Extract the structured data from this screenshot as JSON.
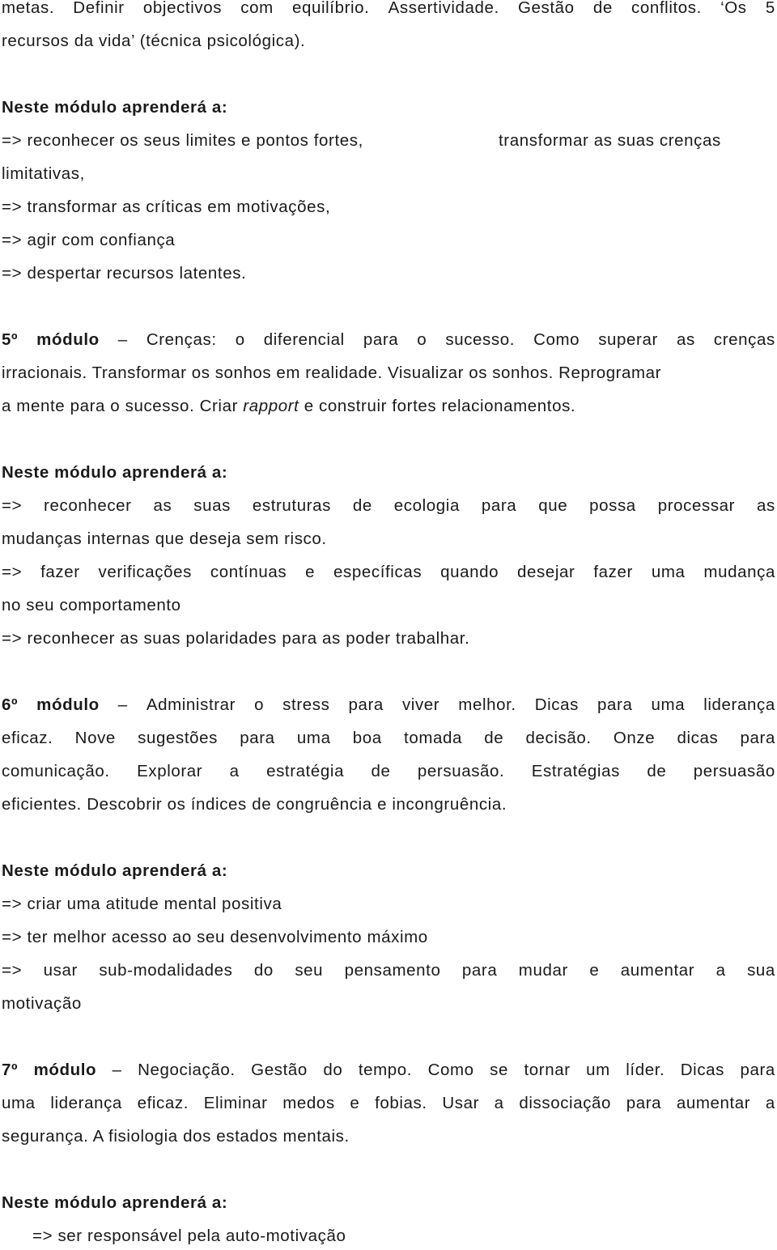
{
  "intro": {
    "line1": [
      "metas.",
      "Definir",
      "objectivos",
      "com",
      "equilíbrio.",
      "Assertividade.",
      "Gestão",
      "de",
      "conflitos.",
      "‘Os",
      "5"
    ],
    "line2": "recursos da vida’ (técnica psicológica)."
  },
  "module4_learn": {
    "heading": "Neste módulo aprenderá a:",
    "items": [
      "=> reconhecer os seus limites e pontos fortes,",
      "transformar as suas crenças",
      "limitativas,",
      "=> transformar as críticas em motivações,",
      "=> agir com confiança",
      "=> despertar recursos latentes."
    ]
  },
  "module5": {
    "number": "5º",
    "label": "módulo",
    "dash": "–",
    "line1_rest": [
      "Crenças:",
      "o",
      "diferencial",
      "para",
      "o",
      "sucesso.",
      "Como",
      "superar",
      "as",
      "crenças"
    ],
    "line2": "irracionais. Transformar os sonhos em realidade. Visualizar os sonhos. Reprogramar",
    "line3_pre": "a mente para o sucesso. Criar ",
    "line3_italic": "rapport",
    "line3_post": " e construir fortes relacionamentos.",
    "learn_heading": "Neste módulo aprenderá a:",
    "learn_line1": [
      "=>",
      "reconhecer",
      "as",
      "suas",
      "estruturas",
      "de",
      "ecologia",
      "para",
      "que",
      "possa",
      "processar",
      "as"
    ],
    "learn_line2": "mudanças internas que deseja sem risco.",
    "learn_line3": [
      "=>",
      "fazer",
      "verificações",
      "contínuas",
      "e",
      "específicas",
      "quando",
      "desejar",
      "fazer",
      "uma",
      "mudança"
    ],
    "learn_line4": "no seu comportamento",
    "learn_line5": "=> reconhecer as suas polaridades para as poder trabalhar."
  },
  "module6": {
    "number": "6º",
    "label": "módulo",
    "dash": "–",
    "line1_rest": [
      "Administrar",
      "o",
      "stress",
      "para",
      "viver",
      "melhor.",
      "Dicas",
      "para",
      "uma",
      "liderança"
    ],
    "line2": [
      "eficaz.",
      "Nove",
      "sugestões",
      "para",
      "uma",
      "boa",
      "tomada",
      "de",
      "decisão.",
      "Onze",
      "dicas",
      "para"
    ],
    "line3": [
      "comunicação.",
      "Explorar",
      "a",
      "estratégia",
      "de",
      "persuasão.",
      "Estratégias",
      "de",
      "persuasão"
    ],
    "line4": "eficientes. Descobrir os índices de congruência e incongruência.",
    "learn_heading": "Neste módulo aprenderá a:",
    "learn_line1": "=> criar uma atitude mental positiva",
    "learn_line2": "=> ter melhor acesso ao seu desenvolvimento máximo",
    "learn_line3": [
      "=>",
      "usar",
      "sub-modalidades",
      "do",
      "seu",
      "pensamento",
      "para",
      "mudar",
      "e",
      "aumentar",
      "a",
      "sua"
    ],
    "learn_line4": "motivação"
  },
  "module7": {
    "number": "7º",
    "label": "módulo",
    "dash": "–",
    "line1_rest": [
      "Negociação.",
      "Gestão",
      "do",
      "tempo.",
      "Como",
      "se",
      "tornar",
      "um",
      "líder.",
      "Dicas",
      "para"
    ],
    "line2": [
      "uma",
      "liderança",
      "eficaz.",
      "Eliminar",
      "medos",
      "e",
      "fobias.",
      "Usar",
      "a",
      "dissociação",
      "para",
      "aumentar",
      "a"
    ],
    "line3": "segurança. A fisiologia dos estados mentais.",
    "learn_heading": "Neste módulo aprenderá a:",
    "learn_line1": "=> ser responsável pela auto-motivação"
  }
}
